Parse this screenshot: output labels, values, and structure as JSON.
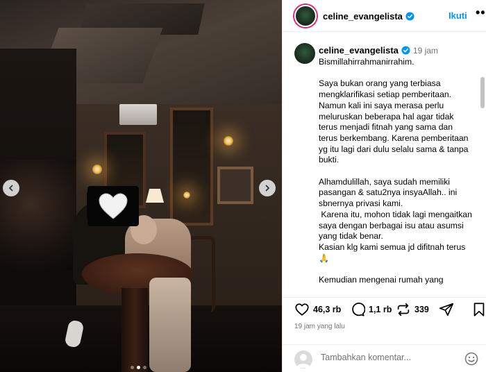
{
  "post": {
    "username": "celine_evangelista",
    "verified": true,
    "follow_label": "Ikuti",
    "more_label": "•••",
    "time_ago": "19 jam",
    "caption": "Bismillahirrahmanirrahim.\n\nSaya bukan orang yang terbiasa mengklarifikasi setiap pemberitaan. Namun kali ini saya merasa perlu meluruskan beberapa hal agar tidak terus menjadi fitnah yang sama dan terus berkembang. Karena pemberitaan yg itu lagi dari dulu selalu sama & tanpa bukti.\n\nAlhamdulillah, saya sudah memiliki pasangan & satu2nya insyaAllah.. ini sbnernya privasi kami.\n Karena itu, mohon tidak lagi mengaitkan saya dengan berbagai isu atau asumsi yang tidak benar.\nKasian klg kami semua jd difitnah terus 🙏\n\nKemudian mengenai rumah yang",
    "likes": "46,3 rb",
    "comments": "1,1 rb",
    "shares": "339",
    "posted_ago": "19 jam yang lalu",
    "comment_placeholder": "Tambahkan komentar..."
  },
  "carousel": {
    "total": 3,
    "active_index": 1
  },
  "icons": {
    "verified": "verified-badge-icon",
    "heart_sticker": "heart-sticker",
    "like": "heart-icon",
    "comment": "comment-bubble-icon",
    "share": "repost-icon",
    "send": "paper-plane-icon",
    "save": "bookmark-icon",
    "emoji": "smiley-icon"
  },
  "colors": {
    "follow": "#0095f6",
    "verified": "#0095f6",
    "secondary_text": "#737373"
  }
}
